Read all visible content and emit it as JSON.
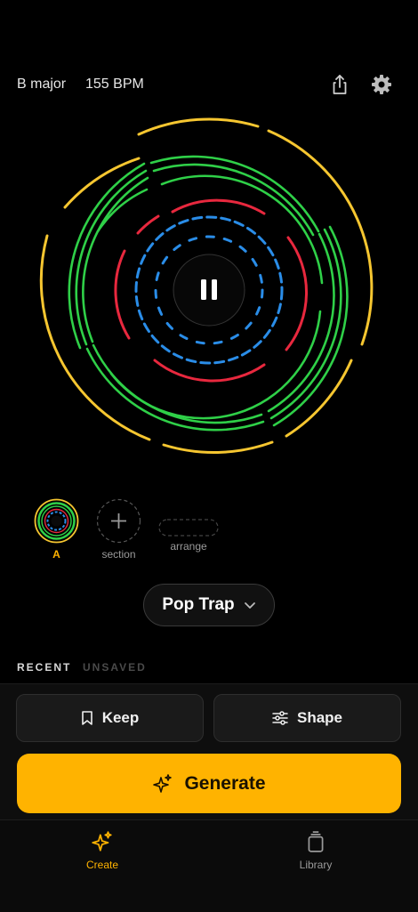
{
  "header": {
    "key": "B major",
    "bpm": "155 BPM",
    "share_icon": "share-icon",
    "settings_icon": "gear-icon"
  },
  "player": {
    "state_icon": "pause-icon",
    "ring_colors": {
      "outer": "#f6c630",
      "green": "#2fd048",
      "red": "#e8283e",
      "blue": "#2a8de8"
    }
  },
  "sections": {
    "items": [
      {
        "label": "A"
      }
    ],
    "add_label": "section",
    "arrange_label": "arrange"
  },
  "genre": {
    "label": "Pop Trap",
    "icon": "chevron-down-icon"
  },
  "tabs": {
    "recent": "RECENT",
    "unsaved": "UNSAVED"
  },
  "actions": {
    "keep": "Keep",
    "shape": "Shape",
    "generate": "Generate",
    "accent": "#ffb300"
  },
  "nav": {
    "create": "Create",
    "library": "Library",
    "active_color": "#ffb300"
  }
}
